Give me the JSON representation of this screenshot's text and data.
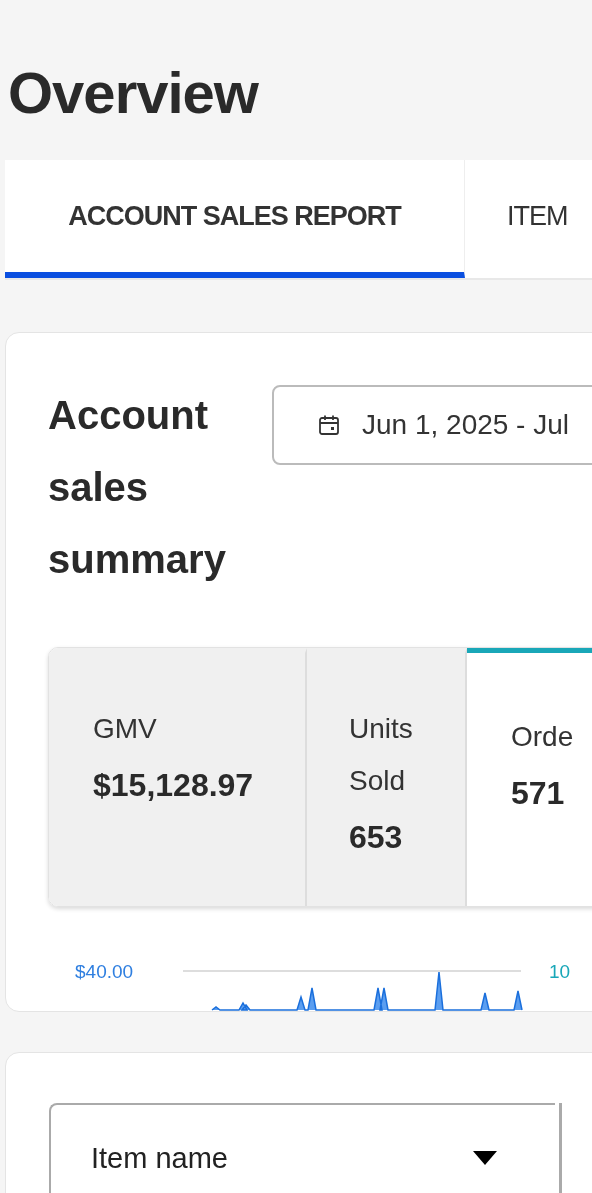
{
  "page_title": "Overview",
  "tabs": [
    {
      "label": "ACCOUNT SALES REPORT",
      "selected": true
    },
    {
      "label": "ITEM",
      "selected": false
    }
  ],
  "summary": {
    "title": "Account sales summary",
    "date_range": "Jun 1, 2025 - Jul",
    "metrics": [
      {
        "label": "GMV",
        "value": "$15,128.97",
        "selected": false
      },
      {
        "label": "Units Sold",
        "value": "653",
        "selected": false
      },
      {
        "label": "Orde",
        "value": "571",
        "selected": true
      }
    ],
    "chart": {
      "left_tick": "$40.00",
      "right_tick": "10"
    }
  },
  "item_filter": {
    "value": "Item name"
  }
}
